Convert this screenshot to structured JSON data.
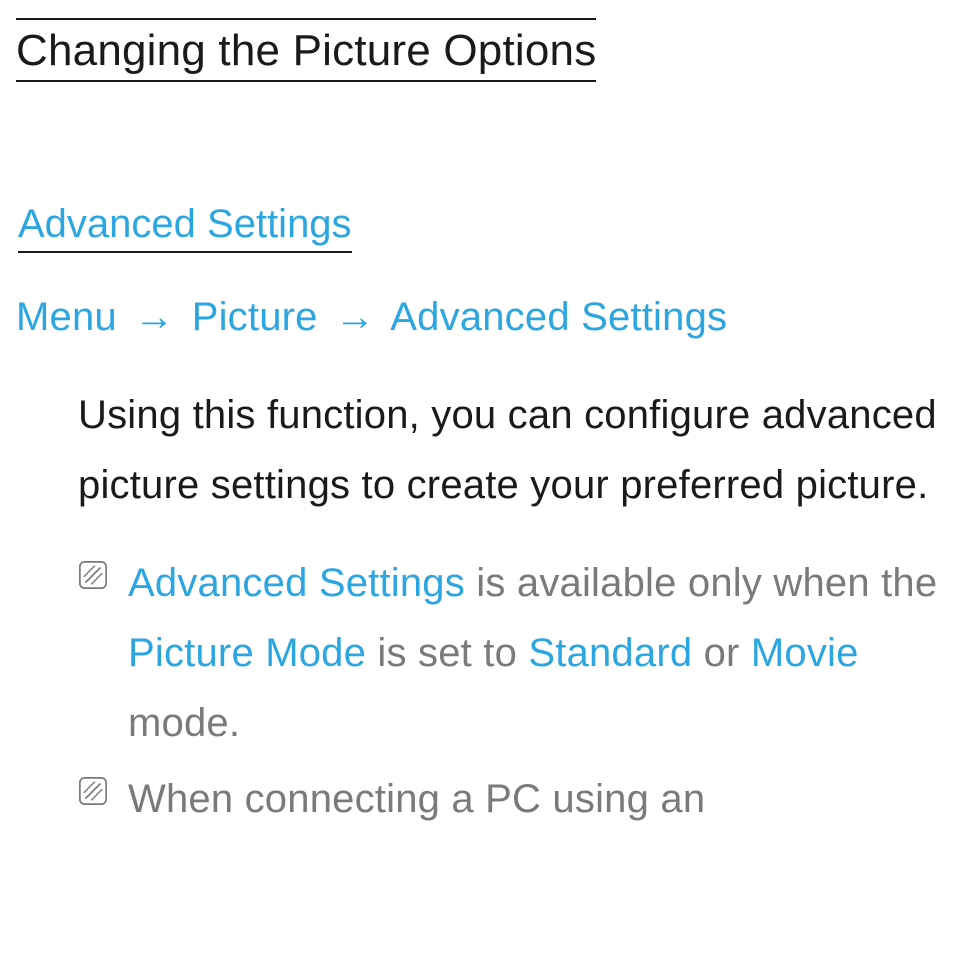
{
  "title": "Changing the Picture Options",
  "section": {
    "heading": "Advanced Settings",
    "breadcrumb": {
      "items": [
        "Menu",
        "Picture",
        "Advanced Settings"
      ],
      "sep": "→"
    },
    "paragraph": "Using this function, you can configure advanced picture settings to create your preferred picture.",
    "notes": [
      {
        "parts": [
          {
            "text": "Advanced Settings",
            "hl": true
          },
          {
            "text": " is available only when the ",
            "hl": false
          },
          {
            "text": "Picture Mode",
            "hl": true
          },
          {
            "text": " is set to ",
            "hl": false
          },
          {
            "text": "Standard",
            "hl": true
          },
          {
            "text": " or ",
            "hl": false
          },
          {
            "text": "Movie",
            "hl": true
          },
          {
            "text": " mode.",
            "hl": false
          }
        ]
      },
      {
        "parts": [
          {
            "text": "When connecting a PC using an",
            "hl": false
          }
        ]
      }
    ]
  }
}
